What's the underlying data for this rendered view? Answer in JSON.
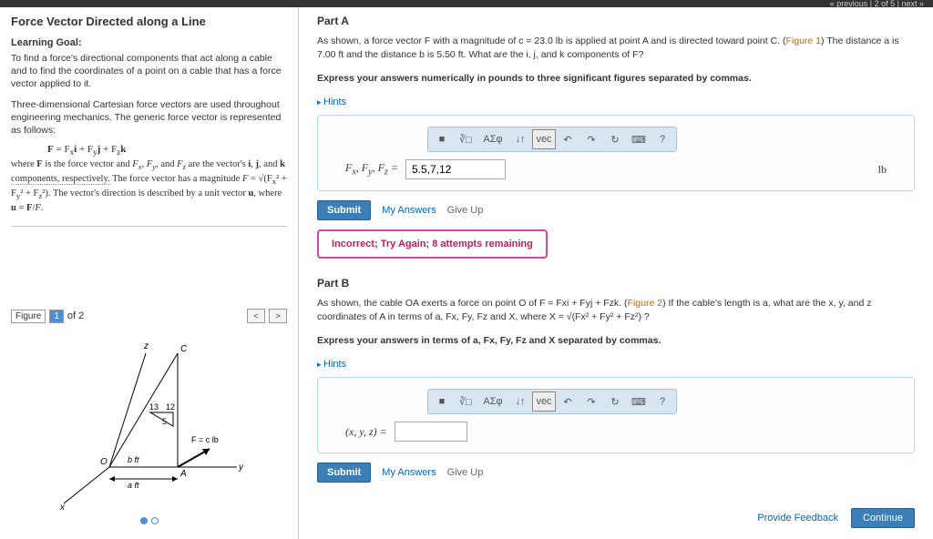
{
  "topbar": {
    "nav": "« previous | 2 of 5 | next »"
  },
  "left": {
    "title": "Force Vector Directed along a Line",
    "lg_label": "Learning Goal:",
    "lg_text": "To find a force's directional components that act along a cable and to find the coordinates of a point on a cable that has a force vector applied to it.",
    "intro": "Three-dimensional Cartesian force vectors are used throughout engineering mechanics. The generic force vector is represented as follows:",
    "formula1": "F = Fxi + Fyj + Fzk",
    "body1": "where F is the force vector and Fx, Fy, and Fz are the vector's i, j, and k components, respectively. The force vector has a magnitude F = √(Fx² + Fy² + Fz²). The vector's direction is described by a unit vector u, where u = F/F.",
    "fig_label": "Figure",
    "fig_sel": "1",
    "fig_total": "of 2"
  },
  "partA": {
    "title": "Part A",
    "text1": "As shown, a force vector F with a magnitude of c = 23.0 lb is applied at point A and is directed toward point C. (",
    "figlink": "Figure 1",
    "text2": ") The distance a is 7.00 ft and the distance b is 5.50 ft. What are the i, j, and k components of F?",
    "instr": "Express your answers numerically in pounds to three significant figures separated by commas.",
    "hints": "Hints",
    "label": "Fx, Fy, Fz =",
    "value": "5.5,7,12",
    "unit": "lb",
    "submit": "Submit",
    "my_answers": "My Answers",
    "give_up": "Give Up",
    "feedback": "Incorrect; Try Again; 8 attempts remaining"
  },
  "partB": {
    "title": "Part B",
    "text1": "As shown, the cable OA exerts a force on point O of F = Fxi + Fyj + Fzk. (",
    "figlink": "Figure 2",
    "text2": ") If the cable's length is a, what are the x, y, and z coordinates of A in terms of a, Fx, Fy, Fz and X, where X = √(Fx² + Fy² + Fz²) ?",
    "instr": "Express your answers in terms of a, Fx, Fy, Fz and X separated by commas.",
    "hints": "Hints",
    "label": "(x, y, z) =",
    "submit": "Submit",
    "my_answers": "My Answers",
    "give_up": "Give Up"
  },
  "footer": {
    "provide_feedback": "Provide Feedback",
    "continue": "Continue"
  },
  "toolbar_icons": [
    "■",
    "∛□",
    "ΑΣφ",
    "↓↑",
    "vec",
    "↶",
    "↷",
    "↻",
    "⌨",
    "?"
  ],
  "figure": {
    "z": "z",
    "y": "y",
    "x": "x",
    "c": "C",
    "o": "O",
    "a": "A",
    "l13": "13",
    "l12": "12",
    "l5": "5",
    "bft": "b ft",
    "aft": "a ft",
    "fc": "F = c lb"
  }
}
